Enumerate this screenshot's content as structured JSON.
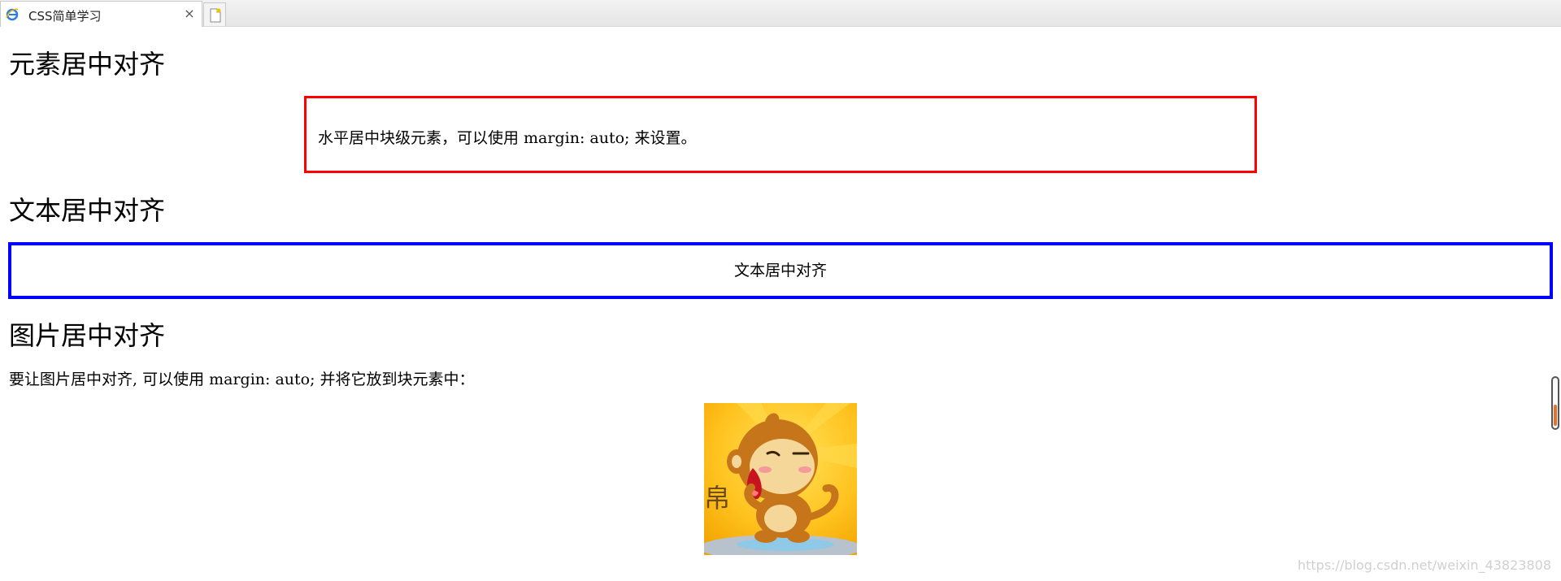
{
  "tab": {
    "title": "CSS简单学习",
    "close_symbol": "×",
    "favicon": "ie-icon"
  },
  "sections": {
    "center_element": {
      "heading": "元素居中对齐",
      "box_text": "水平居中块级元素，可以使用 margin: auto; 来设置。",
      "box_border_color": "#ff0000"
    },
    "center_text": {
      "heading": "文本居中对齐",
      "box_text": "文本居中对齐",
      "box_border_color": "#0000ff"
    },
    "center_image": {
      "heading": "图片居中对齐",
      "intro": "要让图片居中对齐, 可以使用 margin: auto; 并将它放到块元素中：",
      "image": "monkey-cartoon-image"
    }
  },
  "watermark": "https://blog.csdn.net/weixin_43823808",
  "colors": {
    "scroll_thumb": "#e8702a"
  }
}
